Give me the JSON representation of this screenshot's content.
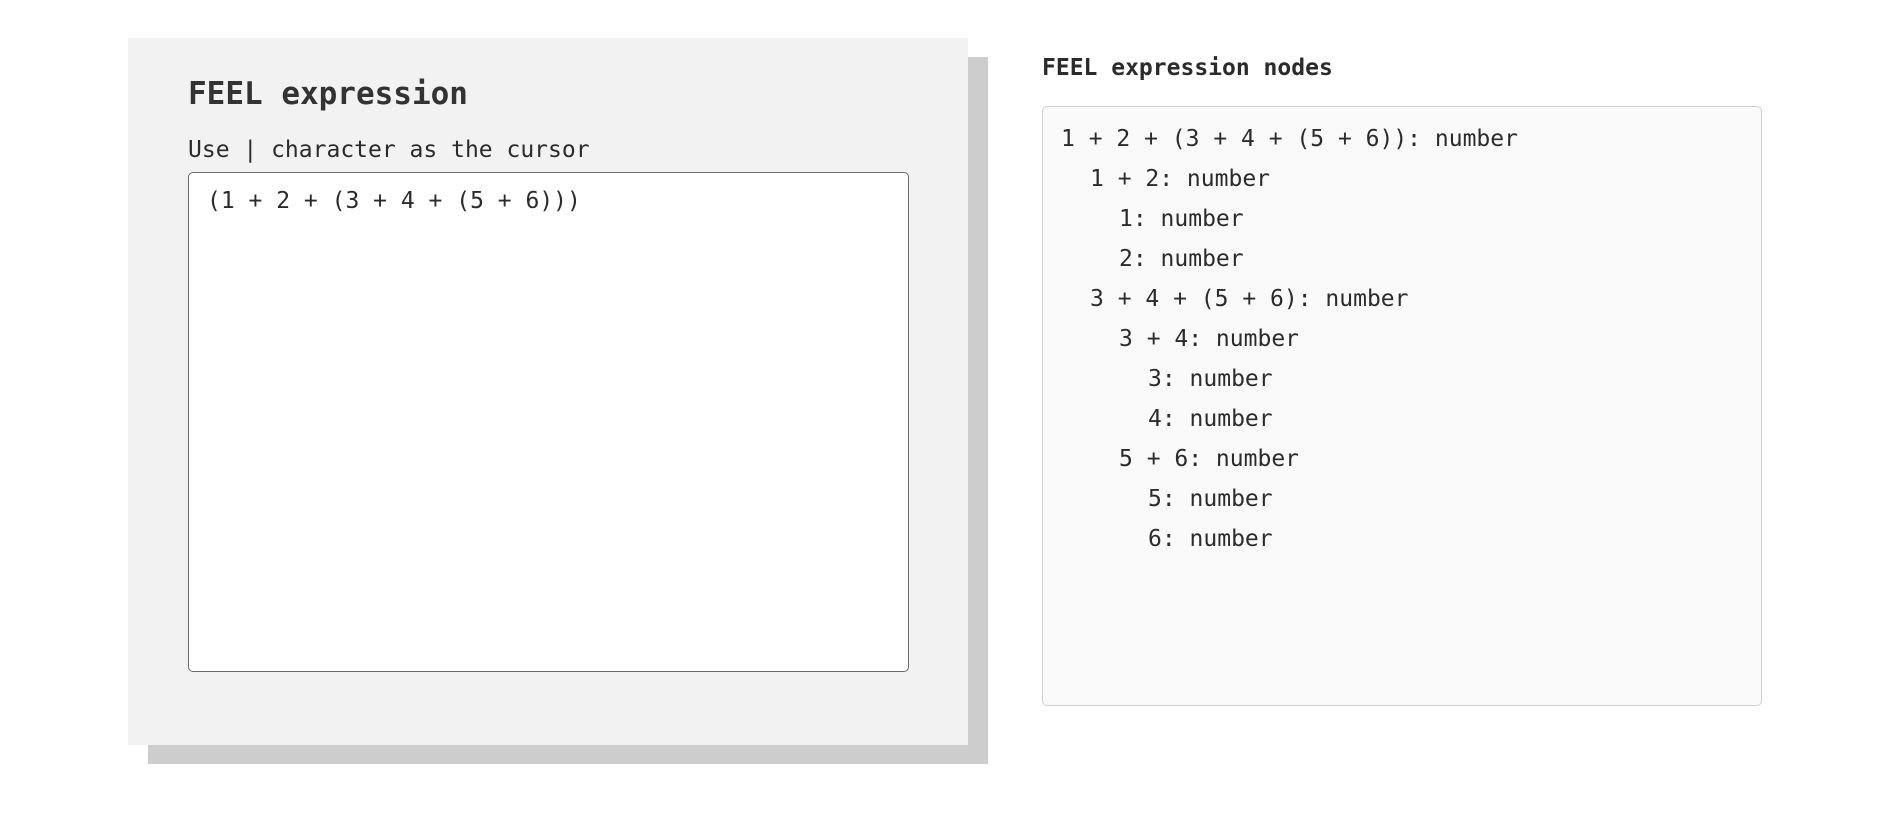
{
  "editor": {
    "title": "FEEL expression",
    "hint": "Use | character as the cursor",
    "value": "(1 + 2 + (3 + 4 + (5 + 6)))"
  },
  "nodes": {
    "title": "FEEL expression nodes",
    "items": [
      {
        "text": "1 + 2 + (3 + 4 + (5 + 6)): number",
        "depth": 0
      },
      {
        "text": "1 + 2: number",
        "depth": 1
      },
      {
        "text": "1: number",
        "depth": 2
      },
      {
        "text": "2: number",
        "depth": 2
      },
      {
        "text": "3 + 4 + (5 + 6): number",
        "depth": 1
      },
      {
        "text": "3 + 4: number",
        "depth": 2
      },
      {
        "text": "3: number",
        "depth": 3
      },
      {
        "text": "4: number",
        "depth": 3
      },
      {
        "text": "5 + 6: number",
        "depth": 2
      },
      {
        "text": "5: number",
        "depth": 3
      },
      {
        "text": "6: number",
        "depth": 3
      }
    ]
  }
}
